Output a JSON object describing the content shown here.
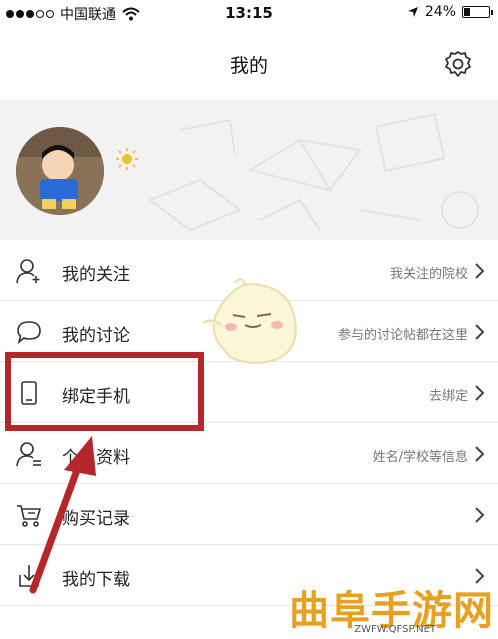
{
  "status_bar": {
    "carrier": "中国联通",
    "time": "13:15",
    "battery": "24%",
    "battery_level": 0.24
  },
  "header": {
    "title": "我的"
  },
  "menu": {
    "items": [
      {
        "label": "我的关注",
        "hint": "我关注的院校",
        "icon": "user-plus-icon"
      },
      {
        "label": "我的讨论",
        "hint": "参与的讨论帖都在这里",
        "icon": "chat-bubble-icon"
      },
      {
        "label": "绑定手机",
        "hint": "去绑定",
        "icon": "phone-icon"
      },
      {
        "label": "个人资料",
        "hint": "姓名/学校等信息",
        "icon": "profile-icon"
      },
      {
        "label": "购买记录",
        "hint": "",
        "icon": "cart-icon"
      },
      {
        "label": "我的下载",
        "hint": "",
        "icon": "download-icon"
      }
    ]
  },
  "watermark": {
    "title": "曲阜手游网",
    "url": "ZWFW.QFSP.NET"
  },
  "colors": {
    "highlight": "#b5272a",
    "watermark": "#e8a020"
  }
}
